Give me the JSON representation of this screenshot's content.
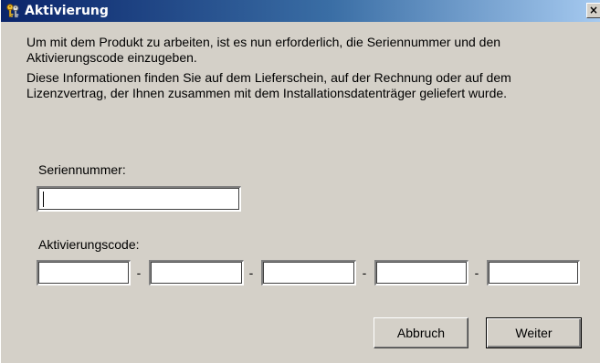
{
  "window": {
    "title": "Aktivierung",
    "icon": "keys-icon",
    "close_label": "×"
  },
  "intro": {
    "line1": "Um mit dem Produkt zu arbeiten, ist es nun erforderlich, die Seriennummer und den",
    "line2": "Aktivierungscode einzugeben.",
    "line3": "Diese Informationen finden Sie auf dem Lieferschein, auf der Rechnung oder auf dem",
    "line4": "Lizenzvertrag, der Ihnen zusammen mit dem Installationsdatenträger geliefert wurde."
  },
  "serial": {
    "label": "Seriennummer:",
    "value": ""
  },
  "activation": {
    "label": "Aktivierungscode:",
    "separator": "-",
    "segments": [
      "",
      "",
      "",
      "",
      ""
    ]
  },
  "buttons": {
    "cancel": "Abbruch",
    "next": "Weiter"
  },
  "colors": {
    "titlebar_start": "#0a246a",
    "titlebar_end": "#a6caf0",
    "face": "#d4d0c8"
  }
}
